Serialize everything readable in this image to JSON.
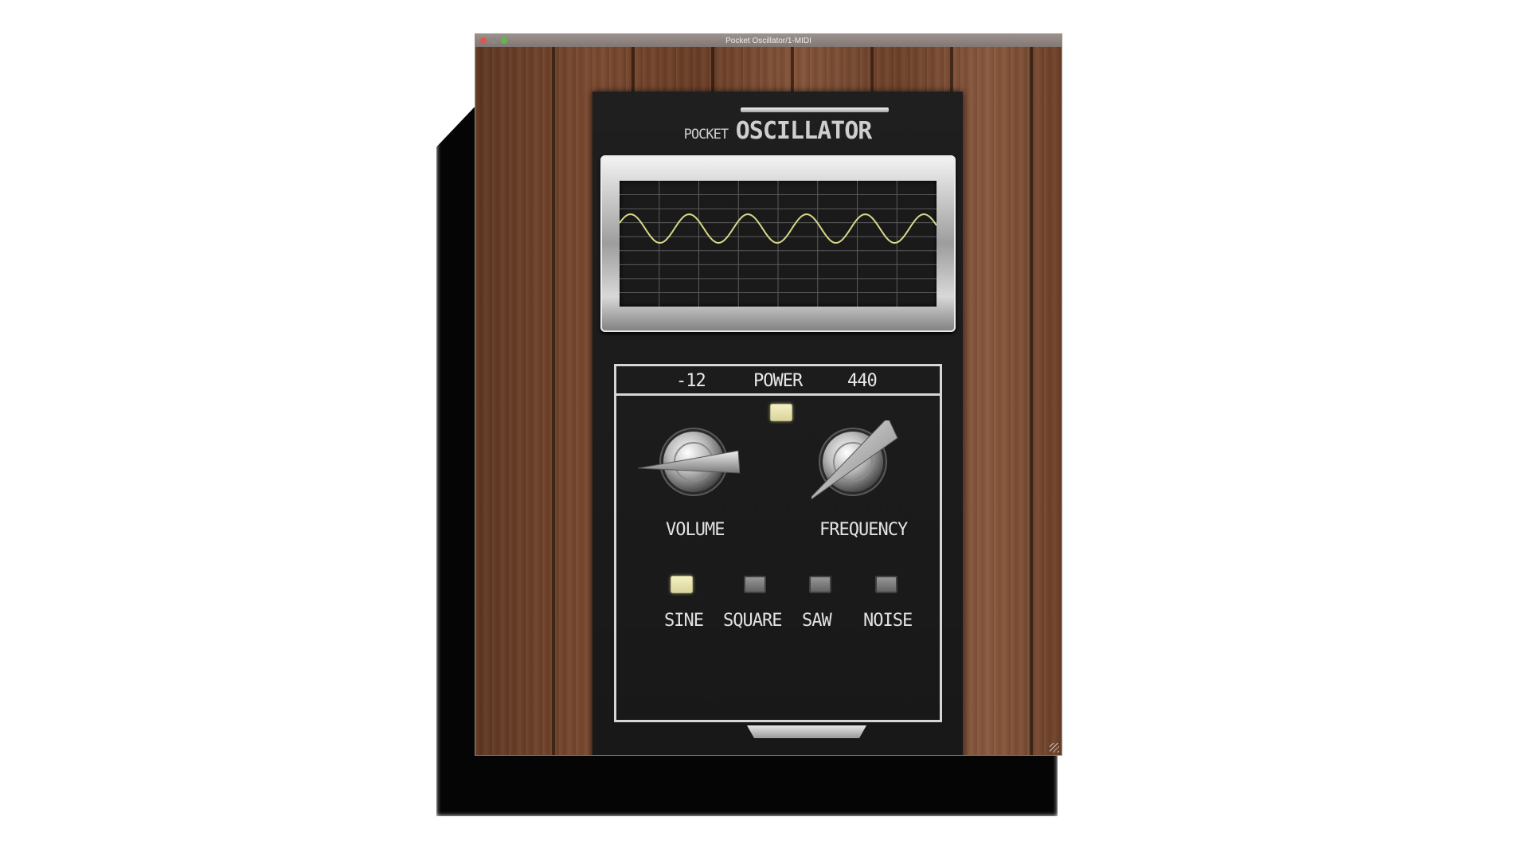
{
  "window": {
    "title": "Pocket Oscillator/1-MIDI"
  },
  "brand": {
    "small": "POCKET",
    "big": "OSCILLATOR"
  },
  "header": {
    "volume_value": "-12",
    "power_label": "POWER",
    "frequency_value": "440"
  },
  "power": {
    "on": true
  },
  "knobs": {
    "volume_label": "VOLUME",
    "frequency_label": "FREQUENCY"
  },
  "waveforms": [
    {
      "label": "SINE",
      "active": true
    },
    {
      "label": "SQUARE",
      "active": false
    },
    {
      "label": "SAW",
      "active": false
    },
    {
      "label": "NOISE",
      "active": false
    }
  ],
  "colors": {
    "led_on": "#f2eebf",
    "trace": "#d8d88a",
    "device_bg": "#1c1c1c"
  },
  "icons": {
    "close": "close-icon",
    "minimize": "minimize-icon",
    "maximize": "maximize-icon"
  }
}
